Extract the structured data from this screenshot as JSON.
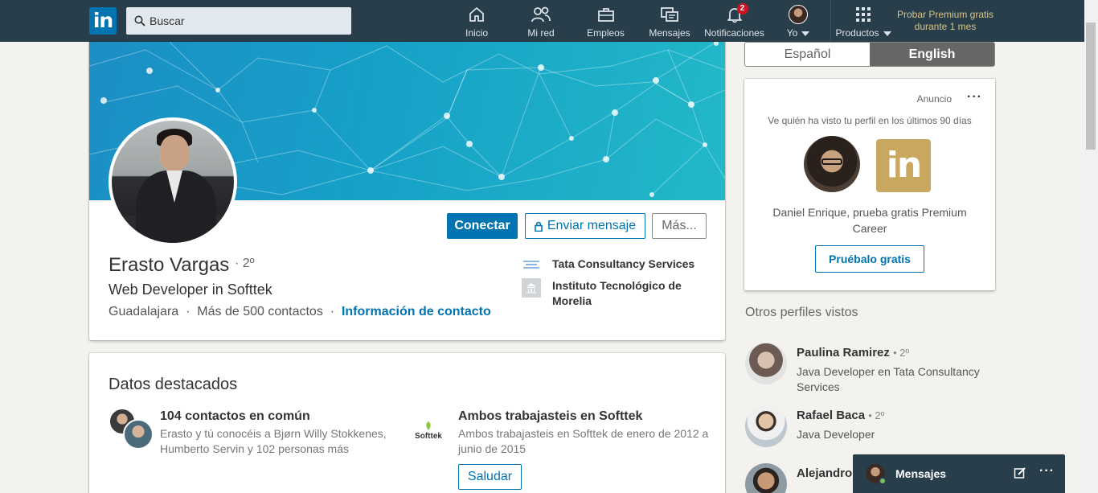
{
  "nav": {
    "logo_text": "in",
    "search_placeholder": "Buscar",
    "items": [
      {
        "label": "Inicio",
        "icon": "home-icon"
      },
      {
        "label": "Mi red",
        "icon": "network-icon"
      },
      {
        "label": "Empleos",
        "icon": "briefcase-icon"
      },
      {
        "label": "Mensajes",
        "icon": "messages-icon"
      },
      {
        "label": "Notificaciones",
        "icon": "bell-icon",
        "badge": "2"
      },
      {
        "label": "Yo",
        "icon": "avatar"
      },
      {
        "label": "Productos",
        "icon": "grid-icon"
      }
    ],
    "premium": "Probar Premium gratis durante 1 mes"
  },
  "profile": {
    "name": "Erasto Vargas",
    "degree": "· 2º",
    "headline": "Web Developer in Softtek",
    "location": "Guadalajara",
    "separator": "·",
    "connections": "Más de 500 contactos",
    "contact_info": "Información de contacto",
    "company": "Tata Consultancy Services",
    "school": "Instituto Tecnológico de Morelia",
    "connect_label": "Conectar",
    "message_label": "Enviar mensaje",
    "more_label": "Más..."
  },
  "highlights": {
    "title": "Datos destacados",
    "mutual": {
      "title": "104 contactos en común",
      "desc": "Erasto y tú conocéis a Bjørn Willy Stokkenes, Humberto Servin y 102 personas más"
    },
    "worked": {
      "logo_text": "Softtek",
      "title": "Ambos trabajasteis en Softtek",
      "desc": "Ambos trabajasteis en Softtek de enero de 2012 a junio de 2015",
      "button": "Saludar"
    }
  },
  "language": {
    "es": "Español",
    "en": "English",
    "active": "English"
  },
  "ad": {
    "label": "Anuncio",
    "menu": "···",
    "subtitle": "Ve quién ha visto tu perfil en los últimos 90 días",
    "logo_text": "in",
    "text": "Daniel Enrique, prueba gratis Premium Career",
    "button": "Pruébalo gratis"
  },
  "others": {
    "title": "Otros perfiles vistos",
    "people": [
      {
        "name": "Paulina Ramirez",
        "degree": "• 2º",
        "title": "Java Developer en Tata Consultancy Services"
      },
      {
        "name": "Rafael Baca",
        "degree": "• 2º",
        "title": "Java Developer"
      },
      {
        "name": "Alejandro",
        "degree": "",
        "title": ""
      }
    ]
  },
  "messaging": {
    "label": "Mensajes",
    "menu": "···"
  },
  "colors": {
    "nav_bg": "#283e4a",
    "accent": "#0073b1",
    "premium_gold": "#c9a75f",
    "badge_red": "#d11124"
  }
}
